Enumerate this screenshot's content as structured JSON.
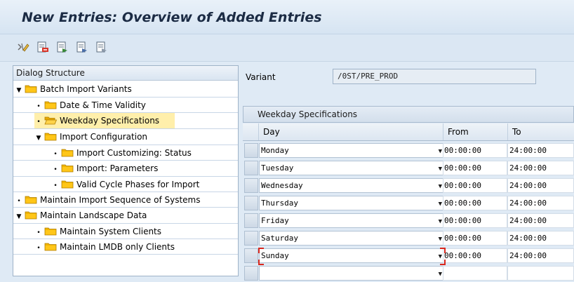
{
  "title": "New Entries: Overview of Added Entries",
  "toolbar": {
    "buttons": [
      "change-display-icon",
      "delete-icon",
      "select-all-icon",
      "select-block-icon",
      "deselect-all-icon"
    ]
  },
  "dialog_structure": {
    "header": "Dialog Structure",
    "items": [
      {
        "label": "Batch Import Variants",
        "level": 0,
        "expander": "open",
        "selected": false
      },
      {
        "label": "Date & Time Validity",
        "level": 1,
        "expander": "leaf",
        "selected": false
      },
      {
        "label": "Weekday Specifications",
        "level": 1,
        "expander": "leaf",
        "selected": true
      },
      {
        "label": "Import Configuration",
        "level": 1,
        "expander": "open",
        "selected": false
      },
      {
        "label": "Import Customizing: Status",
        "level": 2,
        "expander": "leaf",
        "selected": false
      },
      {
        "label": "Import: Parameters",
        "level": 2,
        "expander": "leaf",
        "selected": false
      },
      {
        "label": "Valid Cycle Phases for Import",
        "level": 2,
        "expander": "leaf",
        "selected": false
      },
      {
        "label": "Maintain Import Sequence of Systems",
        "level": 0,
        "expander": "leaf",
        "selected": false
      },
      {
        "label": "Maintain Landscape Data",
        "level": 0,
        "expander": "open",
        "selected": false
      },
      {
        "label": "Maintain System Clients",
        "level": 1,
        "expander": "leaf",
        "selected": false
      },
      {
        "label": "Maintain LMDB only Clients",
        "level": 1,
        "expander": "leaf",
        "selected": false
      }
    ]
  },
  "variant": {
    "label": "Variant",
    "value": "/0ST/PRE_PROD"
  },
  "table": {
    "title": "Weekday Specifications",
    "columns": [
      "Day",
      "From",
      "To"
    ],
    "rows": [
      {
        "day": "Monday",
        "from": "00:00:00",
        "to": "24:00:00"
      },
      {
        "day": "Tuesday",
        "from": "00:00:00",
        "to": "24:00:00"
      },
      {
        "day": "Wednesday",
        "from": "00:00:00",
        "to": "24:00:00"
      },
      {
        "day": "Thursday",
        "from": "00:00:00",
        "to": "24:00:00"
      },
      {
        "day": "Friday",
        "from": "00:00:00",
        "to": "24:00:00"
      },
      {
        "day": "Saturday",
        "from": "00:00:00",
        "to": "24:00:00"
      },
      {
        "day": "Sunday",
        "from": "00:00:00",
        "to": "24:00:00"
      }
    ]
  },
  "colors": {
    "selected_row": "#ffefab",
    "focus_marker": "#d9281e",
    "folder": "#f0b400"
  }
}
